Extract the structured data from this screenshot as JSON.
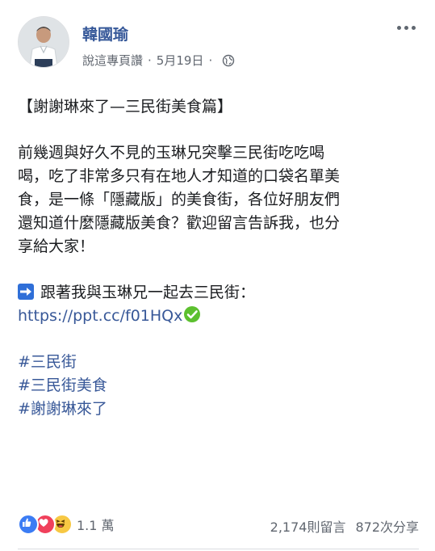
{
  "post": {
    "author": "韓國瑜",
    "meta": {
      "source": "說這專頁讚",
      "date": "5月19日"
    },
    "title": "【謝謝琳來了—三民街美食篇】",
    "body_lines": [
      "前幾週與好久不見的玉琳兄突擊三民街吃吃喝",
      "喝，吃了非常多只有在地人才知道的口袋名單美",
      "食，是一條「隱藏版」的美食街，各位好朋友們",
      "還知道什麼隱藏版美食？歡迎留言告訴我，也分",
      "享給大家！"
    ],
    "cta_text": "跟著我與玉琳兄一起去三民街：",
    "link": "https://ppt.cc/f01HQx",
    "hashtags": [
      "#三民街",
      "#三民街美食",
      "#謝謝琳來了"
    ]
  },
  "footer": {
    "reaction_count": "1.1 萬",
    "comments": "2,174則留言",
    "shares": "872次分享"
  },
  "icons": {
    "avatar": "profile-photo",
    "privacy": "globe-icon",
    "menu": "more-options-icon",
    "arrow": "right-arrow-emoji",
    "check": "check-mark-emoji",
    "reactions": [
      "like-icon",
      "love-icon",
      "haha-icon"
    ]
  },
  "colors": {
    "link": "#385898",
    "author": "#365899",
    "meta": "#616770",
    "check": "#5cc02f",
    "arrow_bg": "#2f6fd8"
  }
}
